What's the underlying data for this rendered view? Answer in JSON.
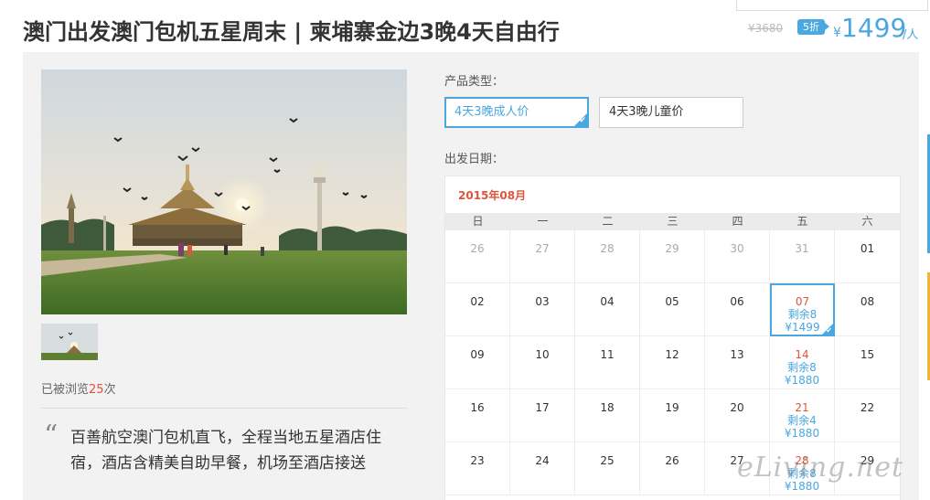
{
  "header": {
    "title": "澳门出发澳门包机五星周末 | 柬埔寨金边3晚4天自由行",
    "old_price": "¥3680",
    "discount": "5折",
    "currency": "¥",
    "price": "1499",
    "unit": "/人"
  },
  "gallery": {
    "main_image": "phnom-penh-royal-palace-photo",
    "thumbnail": "royal-palace-thumbnail"
  },
  "stats": {
    "views_prefix": "已被浏览",
    "views_count": "25",
    "views_suffix": "次"
  },
  "description": {
    "quote_mark": "“",
    "text": "百善航空澳门包机直飞，全程当地五星酒店住宿，酒店含精美自助早餐，机场至酒店接送"
  },
  "product_type": {
    "label": "产品类型：",
    "options": [
      {
        "label": "4天3晚成人价",
        "selected": true
      },
      {
        "label": "4天3晚儿童价",
        "selected": false
      }
    ]
  },
  "departure": {
    "label": "出发日期："
  },
  "calendar": {
    "month": "2015年08月",
    "weekdays": [
      "日",
      "一",
      "二",
      "三",
      "四",
      "五",
      "六"
    ],
    "rows": [
      [
        {
          "day": "26",
          "state": "prev"
        },
        {
          "day": "27",
          "state": "prev"
        },
        {
          "day": "28",
          "state": "prev"
        },
        {
          "day": "29",
          "state": "prev"
        },
        {
          "day": "30",
          "state": "prev"
        },
        {
          "day": "31",
          "state": "prev"
        },
        {
          "day": "01",
          "state": "normal"
        }
      ],
      [
        {
          "day": "02",
          "state": "normal"
        },
        {
          "day": "03",
          "state": "normal"
        },
        {
          "day": "04",
          "state": "normal"
        },
        {
          "day": "05",
          "state": "normal"
        },
        {
          "day": "06",
          "state": "normal"
        },
        {
          "day": "07",
          "state": "selected",
          "remain": "剩余8",
          "price": "¥1499"
        },
        {
          "day": "08",
          "state": "normal"
        }
      ],
      [
        {
          "day": "09",
          "state": "normal"
        },
        {
          "day": "10",
          "state": "normal"
        },
        {
          "day": "11",
          "state": "normal"
        },
        {
          "day": "12",
          "state": "normal"
        },
        {
          "day": "13",
          "state": "normal"
        },
        {
          "day": "14",
          "state": "avail",
          "remain": "剩余8",
          "price": "¥1880"
        },
        {
          "day": "15",
          "state": "normal"
        }
      ],
      [
        {
          "day": "16",
          "state": "normal"
        },
        {
          "day": "17",
          "state": "normal"
        },
        {
          "day": "18",
          "state": "normal"
        },
        {
          "day": "19",
          "state": "normal"
        },
        {
          "day": "20",
          "state": "normal"
        },
        {
          "day": "21",
          "state": "avail",
          "remain": "剩余4",
          "price": "¥1880"
        },
        {
          "day": "22",
          "state": "normal"
        }
      ],
      [
        {
          "day": "23",
          "state": "normal"
        },
        {
          "day": "24",
          "state": "normal"
        },
        {
          "day": "25",
          "state": "normal"
        },
        {
          "day": "26",
          "state": "normal"
        },
        {
          "day": "27",
          "state": "normal"
        },
        {
          "day": "28",
          "state": "avail",
          "remain": "剩余8",
          "price": "¥1880"
        },
        {
          "day": "29",
          "state": "normal"
        }
      ]
    ]
  },
  "watermark": "eLiving.net",
  "colors": {
    "accent": "#4aa7e0",
    "date_highlight": "#e0553a",
    "side_blue": "#4aa7e0",
    "side_orange": "#f0b43c"
  }
}
